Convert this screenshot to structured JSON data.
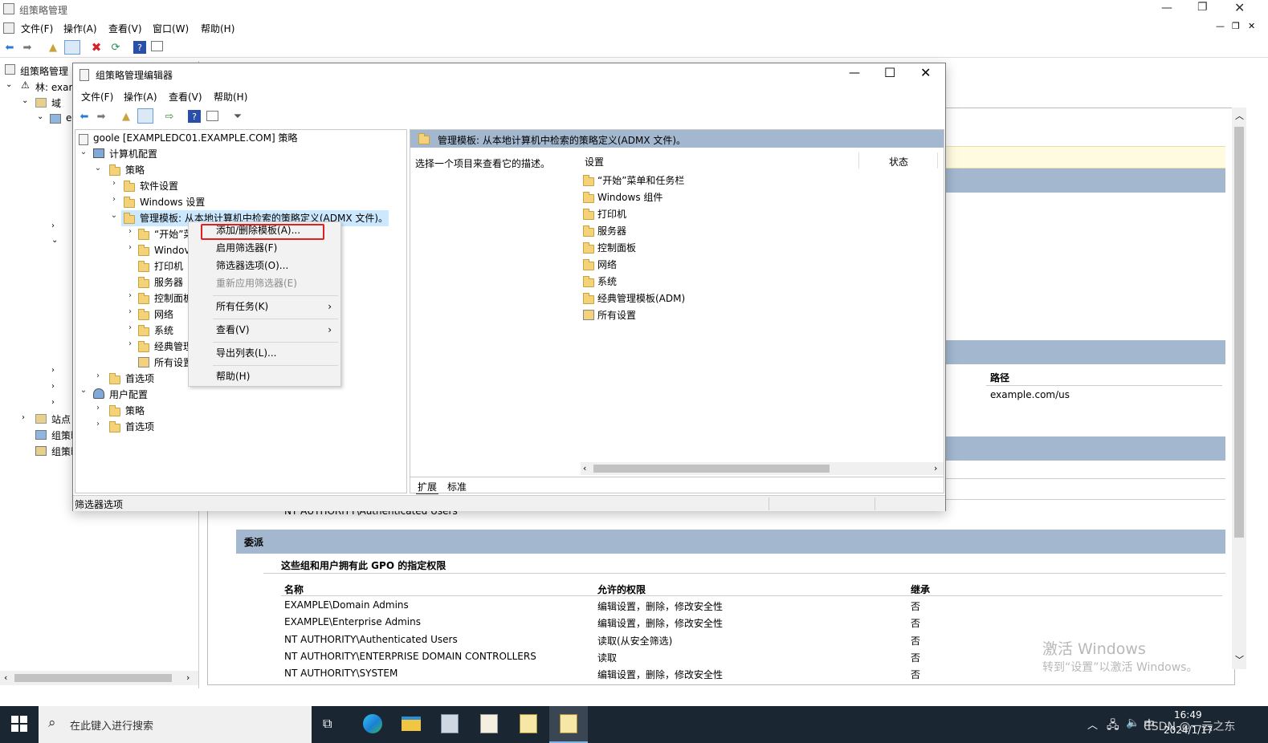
{
  "outer": {
    "title": "组策略管理",
    "menu": [
      "文件(F)",
      "操作(A)",
      "查看(V)",
      "窗口(W)",
      "帮助(H)"
    ],
    "tree_root": "组策略管理",
    "forest": "林: exan",
    "domains": "域",
    "e": "e",
    "sites": "站点",
    "gpm1": "组策略",
    "gpm2": "组策略",
    "path_header": "路径",
    "path_value": "example.com/us",
    "auth_users_partial": "NT AUTHORITY\\Authenticated Users",
    "delegation": {
      "title": "委派",
      "subtitle": "这些组和用户拥有此 GPO 的指定权限",
      "headers": [
        "名称",
        "允许的权限",
        "继承"
      ],
      "rows": [
        [
          "EXAMPLE\\Domain Admins",
          "编辑设置，删除，修改安全性",
          "否"
        ],
        [
          "EXAMPLE\\Enterprise Admins",
          "编辑设置，删除，修改安全性",
          "否"
        ],
        [
          "NT AUTHORITY\\Authenticated Users",
          "读取(从安全筛选)",
          "否"
        ],
        [
          "NT AUTHORITY\\ENTERPRISE DOMAIN CONTROLLERS",
          "读取",
          "否"
        ],
        [
          "NT AUTHORITY\\SYSTEM",
          "编辑设置，删除，修改安全性",
          "否"
        ]
      ]
    },
    "activate1": "激活 Windows",
    "activate2": "转到“设置”以激活 Windows。"
  },
  "editor": {
    "title": "组策略管理编辑器",
    "menu": [
      "文件(F)",
      "操作(A)",
      "查看(V)",
      "帮助(H)"
    ],
    "tree": {
      "root": "goole [EXAMPLEDC01.EXAMPLE.COM] 策略",
      "computer": "计算机配置",
      "policy": "策略",
      "software": "软件设置",
      "windows": "Windows 设置",
      "admx": "管理模板: 从本地计算机中检索的策略定义(ADMX 文件)。",
      "sub": [
        "“开始”菜",
        "Windov",
        "打印机",
        "服务器",
        "控制面板",
        "网络",
        "系统",
        "经典管理",
        "所有设置"
      ],
      "prefs": "首选项",
      "user": "用户配置",
      "upolicy": "策略",
      "uprefs": "首选项"
    },
    "right": {
      "header": "管理模板: 从本地计算机中检索的策略定义(ADMX 文件)。",
      "desc": "选择一个项目来查看它的描述。",
      "col_setting": "设置",
      "col_state": "状态",
      "items": [
        "“开始”菜单和任务栏",
        "Windows 组件",
        "打印机",
        "服务器",
        "控制面板",
        "网络",
        "系统",
        "经典管理模板(ADM)",
        "所有设置"
      ],
      "tabs": [
        "扩展",
        "标准"
      ]
    },
    "status": "筛选器选项"
  },
  "context_menu": [
    "添加/删除模板(A)...",
    "启用筛选器(F)",
    "筛选器选项(O)...",
    "重新应用筛选器(E)",
    "所有任务(K)",
    "查看(V)",
    "导出列表(L)...",
    "帮助(H)"
  ],
  "taskbar": {
    "search": "在此键入进行搜索",
    "time": "16:49",
    "date": "2024/1/17",
    "csdn": "CSDN @一云之东"
  }
}
